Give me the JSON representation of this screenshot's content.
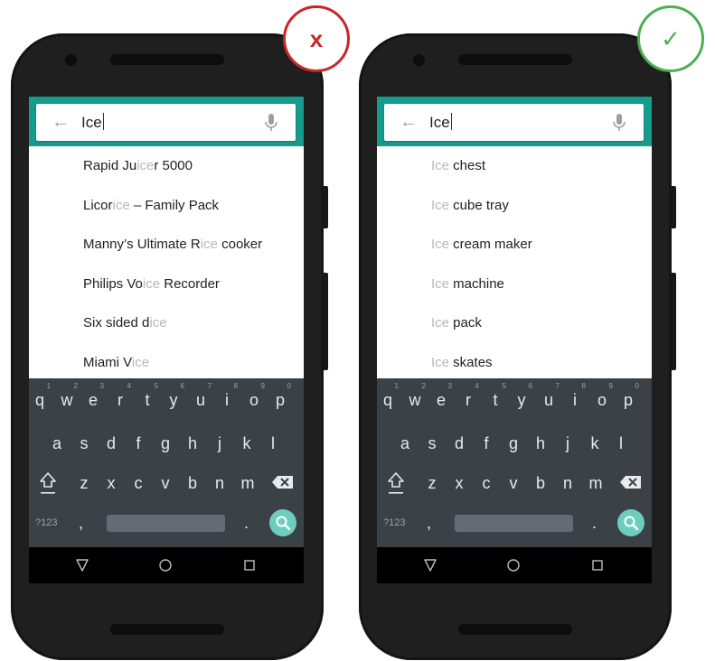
{
  "colors": {
    "app_bar": "#159c8c",
    "bad": "#c62828",
    "good": "#4caf50",
    "highlight": "#b9b9b9",
    "keyboard": "#3a4248"
  },
  "keyboard": {
    "row1": [
      "q",
      "w",
      "e",
      "r",
      "t",
      "y",
      "u",
      "i",
      "o",
      "p"
    ],
    "row1_hints": [
      "1",
      "2",
      "3",
      "4",
      "5",
      "6",
      "7",
      "8",
      "9",
      "0"
    ],
    "row2": [
      "a",
      "s",
      "d",
      "f",
      "g",
      "h",
      "j",
      "k",
      "l"
    ],
    "row3": [
      "z",
      "x",
      "c",
      "v",
      "b",
      "n",
      "m"
    ],
    "numbers_label": "?123",
    "comma": ",",
    "period": "."
  },
  "phones": [
    {
      "verdict_icon": "x-mark",
      "verdict_symbol": "x",
      "query": "Ice",
      "results": [
        {
          "parts": [
            {
              "text": "Rapid Ju",
              "hl": false
            },
            {
              "text": "ice",
              "hl": true
            },
            {
              "text": "r 5000",
              "hl": false
            }
          ]
        },
        {
          "parts": [
            {
              "text": "Licor",
              "hl": false
            },
            {
              "text": "ice",
              "hl": true
            },
            {
              "text": " – Family Pack",
              "hl": false
            }
          ]
        },
        {
          "parts": [
            {
              "text": "Manny’s Ultimate R",
              "hl": false
            },
            {
              "text": "ice",
              "hl": true
            },
            {
              "text": " cooker",
              "hl": false
            }
          ]
        },
        {
          "parts": [
            {
              "text": "Philips Vo",
              "hl": false
            },
            {
              "text": "ice",
              "hl": true
            },
            {
              "text": " Recorder",
              "hl": false
            }
          ]
        },
        {
          "parts": [
            {
              "text": "Six sided d",
              "hl": false
            },
            {
              "text": "ice",
              "hl": true
            }
          ]
        },
        {
          "parts": [
            {
              "text": "Miami V",
              "hl": false
            },
            {
              "text": "ice",
              "hl": true
            }
          ]
        }
      ]
    },
    {
      "verdict_icon": "check-mark",
      "verdict_symbol": "✓",
      "query": "Ice",
      "results": [
        {
          "parts": [
            {
              "text": "Ice",
              "hl": true
            },
            {
              "text": " chest",
              "hl": false
            }
          ]
        },
        {
          "parts": [
            {
              "text": "Ice",
              "hl": true
            },
            {
              "text": " cube tray",
              "hl": false
            }
          ]
        },
        {
          "parts": [
            {
              "text": "Ice",
              "hl": true
            },
            {
              "text": " cream maker",
              "hl": false
            }
          ]
        },
        {
          "parts": [
            {
              "text": "Ice",
              "hl": true
            },
            {
              "text": " machine",
              "hl": false
            }
          ]
        },
        {
          "parts": [
            {
              "text": "Ice",
              "hl": true
            },
            {
              "text": " pack",
              "hl": false
            }
          ]
        },
        {
          "parts": [
            {
              "text": "Ice",
              "hl": true
            },
            {
              "text": " skates",
              "hl": false
            }
          ]
        }
      ]
    }
  ]
}
